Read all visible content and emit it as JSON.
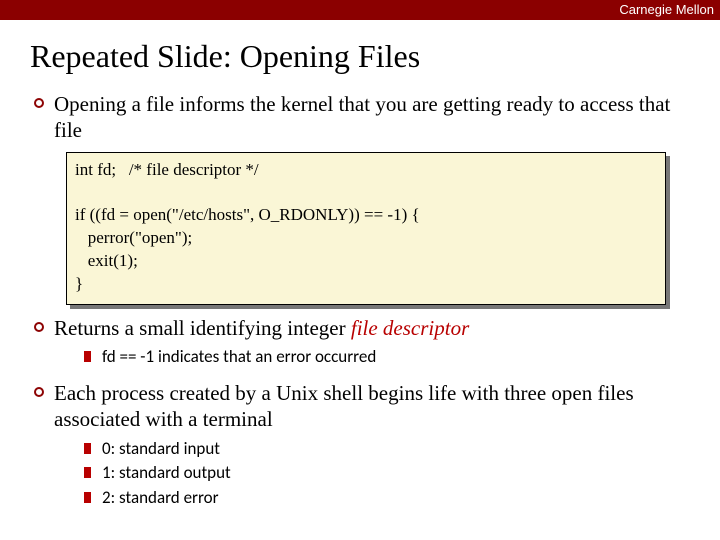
{
  "topbar": "Carnegie Mellon",
  "title": "Repeated Slide: Opening Files",
  "bullets": {
    "b1": "Opening a file informs the kernel that you are getting ready to access that file",
    "b2a": "Returns a small identifying integer ",
    "b2b": "file descriptor",
    "b2_sub1": "fd == -1 indicates that an error occurred",
    "b3": "Each process created by a Unix shell begins life with three open files associated with a terminal",
    "b3_sub1": "0: standard input",
    "b3_sub2": "1: standard output",
    "b3_sub3": "2: standard error"
  },
  "code": {
    "l1": "int fd;   /* file descriptor */",
    "blank": "",
    "l2": "if ((fd = open(\"/etc/hosts\", O_RDONLY)) == -1) {",
    "l3": "   perror(\"open\");",
    "l4": "   exit(1);",
    "l5": "}"
  }
}
